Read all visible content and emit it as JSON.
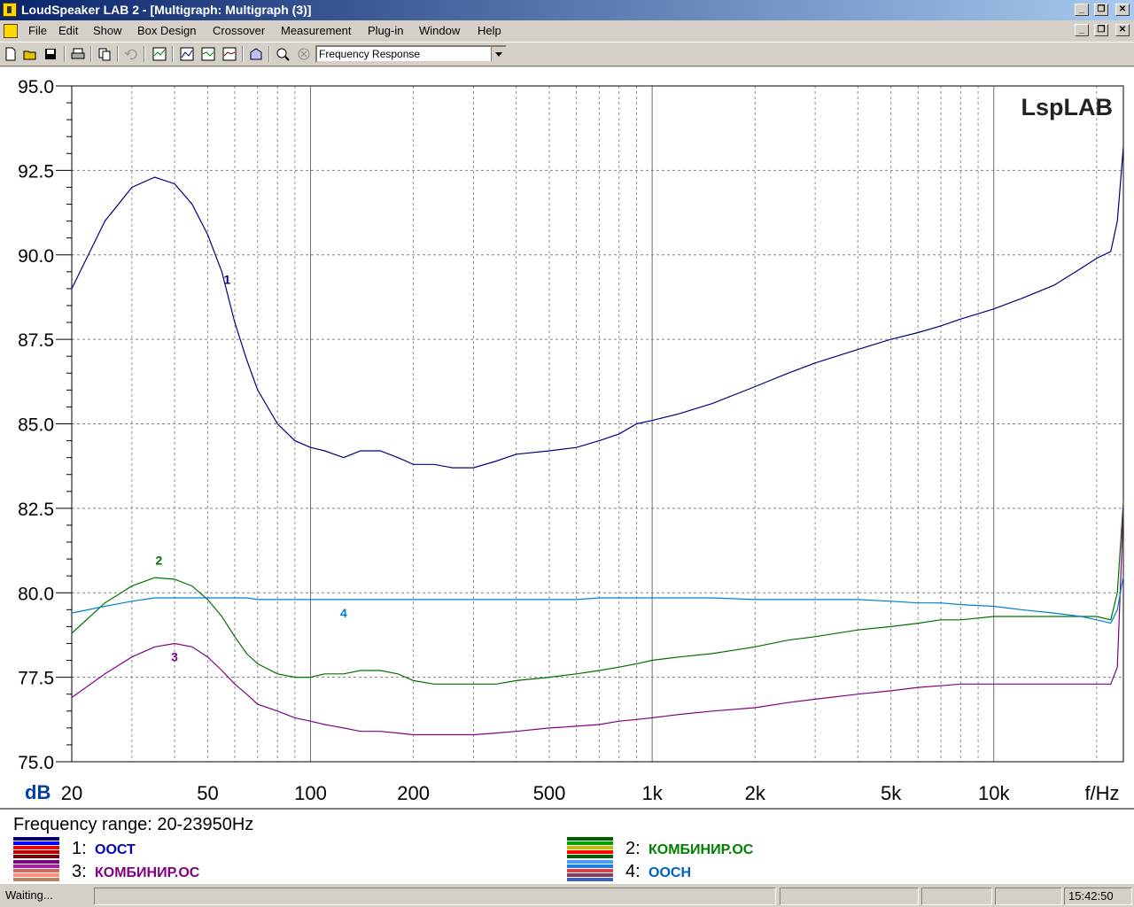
{
  "window": {
    "title": "LoudSpeaker LAB 2 - [Multigraph: Multigraph (3)]"
  },
  "menu": [
    "File",
    "Edit",
    "Show",
    "Box Design",
    "Crossover",
    "Measurement",
    "Plug-in",
    "Window",
    "Help"
  ],
  "toolbar": {
    "view_select": "Frequency Response",
    "icons": [
      "new-icon",
      "open-icon",
      "save-icon",
      "print-icon",
      "copy-icon",
      "undo-icon",
      "multigraph-icon",
      "graph-icon",
      "graph-icon",
      "graph-icon",
      "boxdesign-icon",
      "zoom-icon",
      "stop-icon"
    ]
  },
  "chart_data": {
    "type": "line",
    "xscale": "log",
    "xlim": [
      20,
      23950
    ],
    "ylim": [
      75,
      95
    ],
    "yticks": [
      "75.0",
      "77.5",
      "80.0",
      "82.5",
      "85.0",
      "87.5",
      "90.0",
      "92.5",
      "95.0"
    ],
    "xticks": [
      {
        "value": 20,
        "label": "20"
      },
      {
        "value": 50,
        "label": "50"
      },
      {
        "value": 100,
        "label": "100"
      },
      {
        "value": 200,
        "label": "200"
      },
      {
        "value": 500,
        "label": "500"
      },
      {
        "value": 1000,
        "label": "1k"
      },
      {
        "value": 2000,
        "label": "2k"
      },
      {
        "value": 5000,
        "label": "5k"
      },
      {
        "value": 10000,
        "label": "10k"
      }
    ],
    "ylabel": "dB",
    "xlabel": "f/Hz",
    "watermark": "LspLAB",
    "grid": true,
    "series": [
      {
        "label": "1",
        "color": "#000080",
        "x": [
          20,
          25,
          30,
          35,
          40,
          45,
          50,
          55,
          60,
          65,
          70,
          80,
          90,
          100,
          110,
          125,
          140,
          160,
          180,
          200,
          230,
          260,
          300,
          350,
          400,
          500,
          600,
          700,
          800,
          900,
          1000,
          1200,
          1500,
          2000,
          2500,
          3000,
          4000,
          5000,
          6000,
          7000,
          8000,
          10000,
          12000,
          15000,
          18000,
          20000,
          22000,
          23000,
          23950
        ],
        "y": [
          89.0,
          91.0,
          92.0,
          92.3,
          92.1,
          91.5,
          90.6,
          89.5,
          88.0,
          86.9,
          86.0,
          85.0,
          84.5,
          84.3,
          84.2,
          84.0,
          84.2,
          84.2,
          84.0,
          83.8,
          83.8,
          83.7,
          83.7,
          83.9,
          84.1,
          84.2,
          84.3,
          84.5,
          84.7,
          85.0,
          85.1,
          85.3,
          85.6,
          86.1,
          86.5,
          86.8,
          87.2,
          87.5,
          87.7,
          87.9,
          88.1,
          88.4,
          88.7,
          89.1,
          89.6,
          89.9,
          90.1,
          91.0,
          93.2
        ]
      },
      {
        "label": "2",
        "color": "#007000",
        "x": [
          20,
          25,
          30,
          35,
          40,
          45,
          50,
          55,
          60,
          65,
          70,
          80,
          90,
          100,
          110,
          125,
          140,
          160,
          180,
          200,
          230,
          260,
          300,
          350,
          400,
          500,
          600,
          700,
          800,
          900,
          1000,
          1200,
          1500,
          2000,
          2500,
          3000,
          4000,
          5000,
          6000,
          7000,
          8000,
          10000,
          12000,
          15000,
          18000,
          20000,
          22000,
          23000,
          23950
        ],
        "y": [
          78.8,
          79.7,
          80.2,
          80.45,
          80.4,
          80.2,
          79.8,
          79.3,
          78.7,
          78.2,
          77.9,
          77.6,
          77.5,
          77.5,
          77.6,
          77.6,
          77.7,
          77.7,
          77.6,
          77.4,
          77.3,
          77.3,
          77.3,
          77.3,
          77.4,
          77.5,
          77.6,
          77.7,
          77.8,
          77.9,
          78.0,
          78.1,
          78.2,
          78.4,
          78.6,
          78.7,
          78.9,
          79.0,
          79.1,
          79.2,
          79.2,
          79.3,
          79.3,
          79.3,
          79.3,
          79.3,
          79.2,
          80.0,
          82.7
        ]
      },
      {
        "label": "3",
        "color": "#800080",
        "x": [
          20,
          25,
          30,
          35,
          40,
          45,
          50,
          55,
          60,
          65,
          70,
          80,
          90,
          100,
          110,
          125,
          140,
          160,
          180,
          200,
          230,
          260,
          300,
          350,
          400,
          500,
          600,
          700,
          800,
          900,
          1000,
          1200,
          1500,
          2000,
          2500,
          3000,
          4000,
          5000,
          6000,
          7000,
          8000,
          10000,
          12000,
          15000,
          18000,
          20000,
          22000,
          23000,
          23950
        ],
        "y": [
          76.9,
          77.6,
          78.1,
          78.4,
          78.5,
          78.4,
          78.1,
          77.7,
          77.3,
          77.0,
          76.7,
          76.5,
          76.3,
          76.2,
          76.1,
          76.0,
          75.9,
          75.9,
          75.85,
          75.8,
          75.8,
          75.8,
          75.8,
          75.85,
          75.9,
          76.0,
          76.05,
          76.1,
          76.2,
          76.25,
          76.3,
          76.4,
          76.5,
          76.6,
          76.75,
          76.85,
          77.0,
          77.1,
          77.2,
          77.25,
          77.3,
          77.3,
          77.3,
          77.3,
          77.3,
          77.3,
          77.3,
          77.8,
          82.5
        ]
      },
      {
        "label": "4",
        "color": "#0080d0",
        "x": [
          20,
          25,
          30,
          35,
          40,
          45,
          50,
          55,
          60,
          65,
          70,
          80,
          90,
          100,
          110,
          125,
          140,
          160,
          180,
          200,
          230,
          260,
          300,
          350,
          400,
          500,
          600,
          700,
          800,
          900,
          1000,
          1200,
          1500,
          2000,
          2500,
          3000,
          4000,
          5000,
          6000,
          7000,
          8000,
          10000,
          12000,
          15000,
          18000,
          20000,
          22000,
          23000,
          23950
        ],
        "y": [
          79.4,
          79.6,
          79.75,
          79.85,
          79.85,
          79.85,
          79.85,
          79.85,
          79.85,
          79.85,
          79.8,
          79.8,
          79.8,
          79.8,
          79.8,
          79.8,
          79.8,
          79.8,
          79.8,
          79.8,
          79.8,
          79.8,
          79.8,
          79.8,
          79.8,
          79.8,
          79.8,
          79.85,
          79.85,
          79.85,
          79.85,
          79.85,
          79.85,
          79.8,
          79.8,
          79.8,
          79.8,
          79.75,
          79.7,
          79.7,
          79.65,
          79.6,
          79.5,
          79.4,
          79.3,
          79.2,
          79.1,
          79.5,
          80.5
        ]
      }
    ]
  },
  "legend": {
    "frequency_range": "Frequency range: 20-23950Hz",
    "entries": [
      {
        "num": "1:",
        "name": "ООСТ",
        "name_color": "#0000c0",
        "colors": [
          "#000080",
          "#0000ff",
          "#ff0000",
          "#c00000",
          "#800000"
        ]
      },
      {
        "num": "2:",
        "name": "КОМБИНИР.ОС",
        "name_color": "#008000",
        "colors": [
          "#006000",
          "#00a000",
          "#c0c000",
          "#ff0000",
          "#006000"
        ]
      },
      {
        "num": "3:",
        "name": "КОМБИНИР.ОС",
        "name_color": "#800080",
        "colors": [
          "#800080",
          "#a020a0",
          "#e06060",
          "#ff9080",
          "#c08060"
        ]
      },
      {
        "num": "4:",
        "name": "ООСН",
        "name_color": "#0060c0",
        "colors": [
          "#40a0ff",
          "#2080e0",
          "#e04040",
          "#804060",
          "#4060c0"
        ]
      }
    ]
  },
  "status": {
    "text": "Waiting...",
    "time": "15:42:50"
  }
}
